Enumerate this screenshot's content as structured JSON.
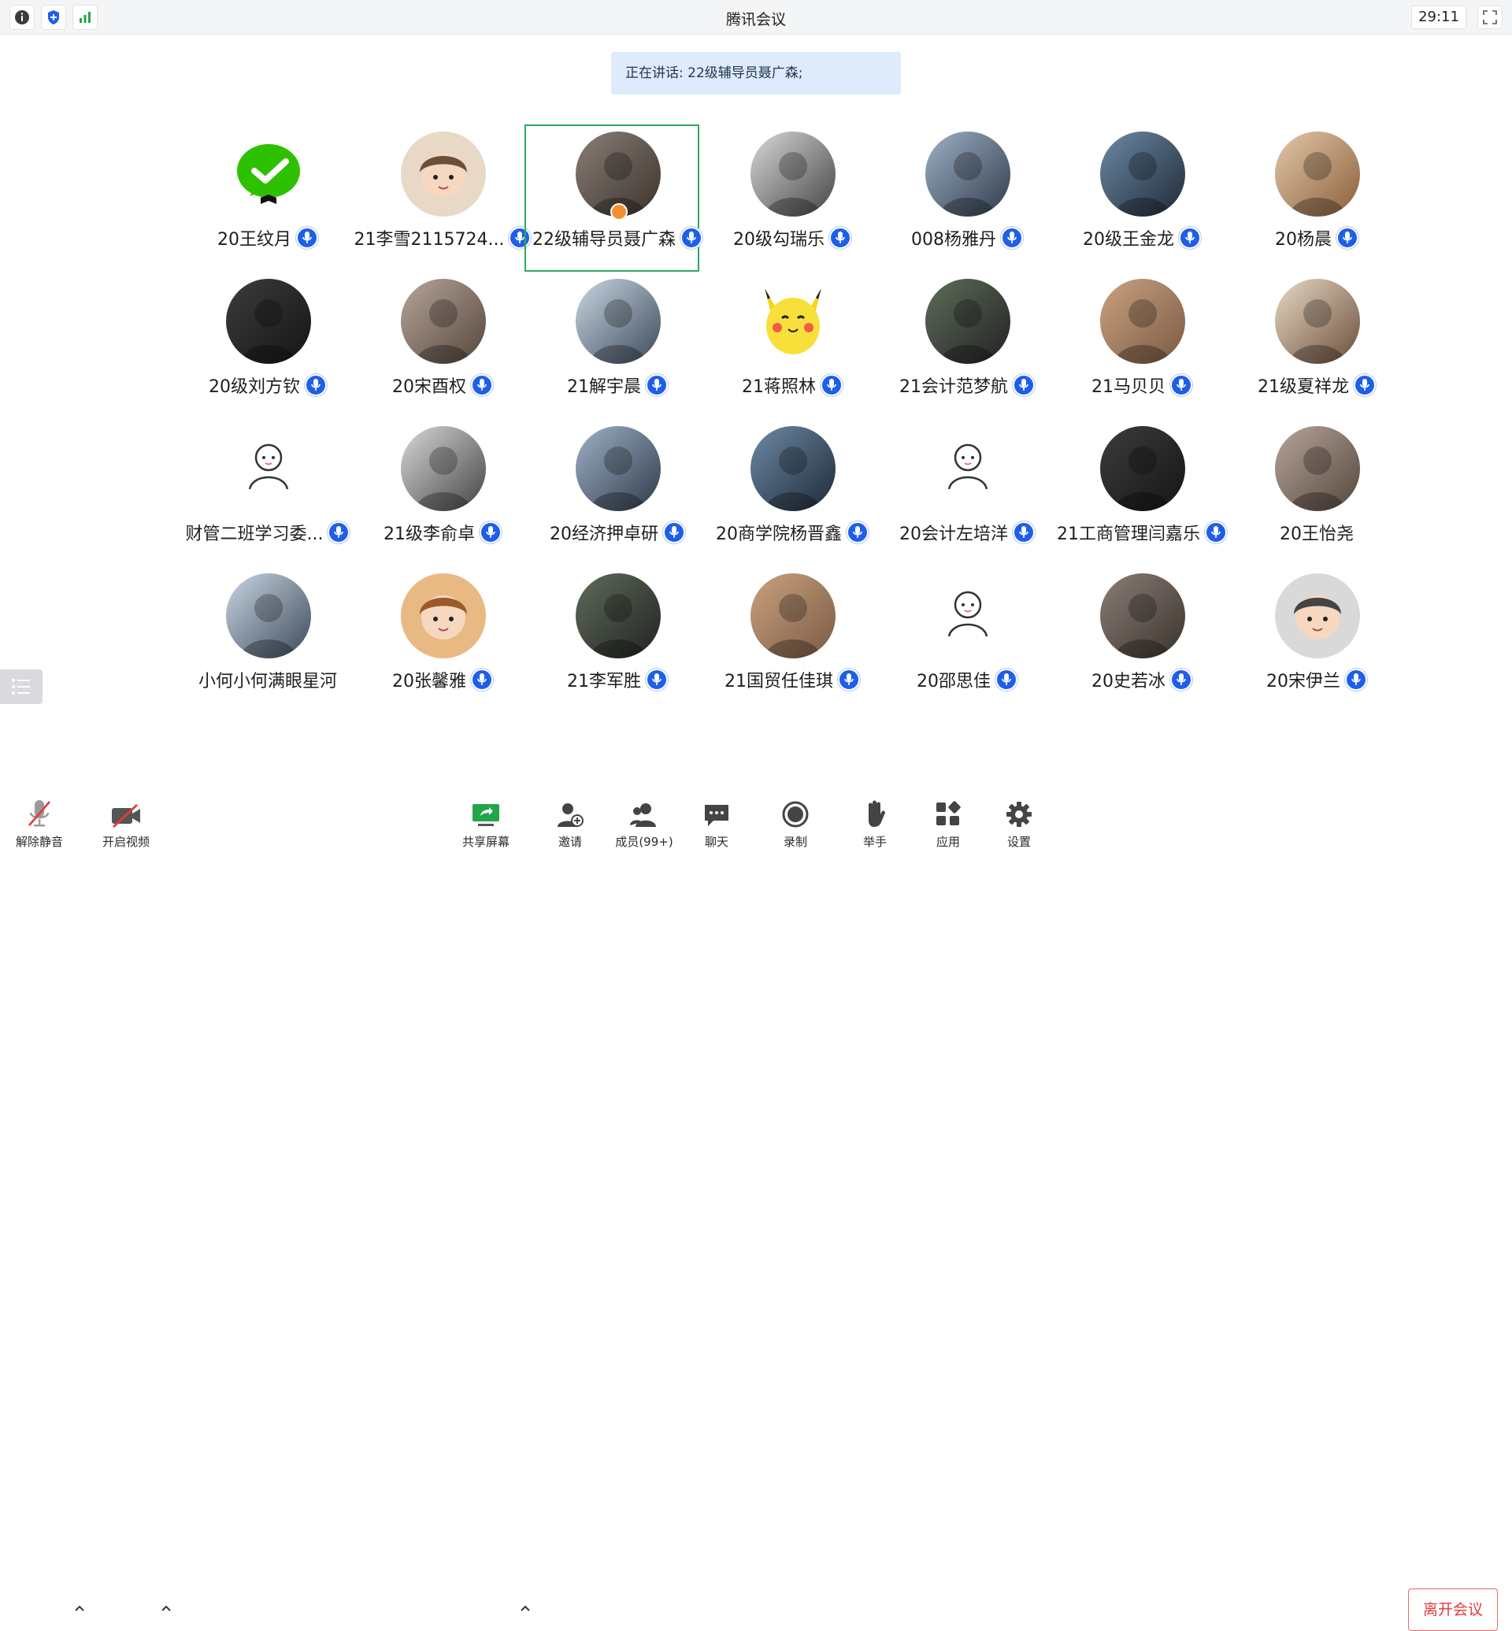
{
  "window": {
    "title": "腾讯会议",
    "timer": "29:11"
  },
  "banner": {
    "speaking_text": "正在讲话: 22级辅导员聂广森;"
  },
  "participants": [
    {
      "name": "20王纹月",
      "mic": true,
      "avatar": "wechat-logo-avatar"
    },
    {
      "name": "21李雪2115724...",
      "mic": true,
      "avatar": "cartoon-avatar"
    },
    {
      "name": "22级辅导员聂广森",
      "mic": true,
      "speaking": true,
      "host": true,
      "avatar": "photo-avatar"
    },
    {
      "name": "20级勾瑞乐",
      "mic": true,
      "avatar": "photo-avatar"
    },
    {
      "name": "008杨雅丹",
      "mic": true,
      "avatar": "photo-avatar"
    },
    {
      "name": "20级王金龙",
      "mic": true,
      "avatar": "photo-avatar"
    },
    {
      "name": "20杨晨",
      "mic": true,
      "avatar": "photo-avatar"
    },
    {
      "name": "20级刘方钦",
      "mic": true,
      "avatar": "photo-avatar"
    },
    {
      "name": "20宋酉权",
      "mic": true,
      "avatar": "photo-avatar"
    },
    {
      "name": "21解宇晨",
      "mic": true,
      "avatar": "photo-avatar"
    },
    {
      "name": "21蒋照林",
      "mic": true,
      "avatar": "pikachu-avatar"
    },
    {
      "name": "21会计范梦航",
      "mic": true,
      "avatar": "photo-avatar"
    },
    {
      "name": "21马贝贝",
      "mic": true,
      "avatar": "photo-avatar"
    },
    {
      "name": "21级夏祥龙",
      "mic": true,
      "avatar": "photo-avatar"
    },
    {
      "name": "财管二班学习委...",
      "mic": true,
      "avatar": "sketch-avatar"
    },
    {
      "name": "21级李俞卓",
      "mic": true,
      "avatar": "photo-avatar"
    },
    {
      "name": "20经济押卓研",
      "mic": true,
      "avatar": "photo-avatar"
    },
    {
      "name": "20商学院杨晋鑫",
      "mic": true,
      "avatar": "photo-avatar"
    },
    {
      "name": "20会计左培洋",
      "mic": true,
      "avatar": "sketch-avatar"
    },
    {
      "name": "21工商管理闫嘉乐",
      "mic": true,
      "avatar": "photo-avatar"
    },
    {
      "name": "20王怡尧",
      "mic": false,
      "avatar": "photo-avatar"
    },
    {
      "name": "小何小何满眼星河",
      "mic": false,
      "avatar": "photo-avatar"
    },
    {
      "name": "20张馨雅",
      "mic": true,
      "avatar": "cartoon-avatar"
    },
    {
      "name": "21李军胜",
      "mic": true,
      "avatar": "photo-avatar"
    },
    {
      "name": "21国贸任佳琪",
      "mic": true,
      "avatar": "photo-avatar"
    },
    {
      "name": "20邵思佳",
      "mic": true,
      "avatar": "sketch-avatar"
    },
    {
      "name": "20史若冰",
      "mic": true,
      "avatar": "photo-avatar"
    },
    {
      "name": "20宋伊兰",
      "mic": true,
      "avatar": "cartoon-avatar"
    }
  ],
  "toolbar": {
    "unmute": "解除静音",
    "video": "开启视频",
    "share": "共享屏幕",
    "invite": "邀请",
    "members": "成员(99+)",
    "chat": "聊天",
    "record": "录制",
    "raise_hand": "举手",
    "apps": "应用",
    "settings": "设置",
    "leave": "离开会议"
  },
  "colors": {
    "accent_blue": "#1f5fe8",
    "active_speaker_border": "#2ea960",
    "leave_red": "#e23b3b",
    "banner_bg": "#ddebfb"
  }
}
